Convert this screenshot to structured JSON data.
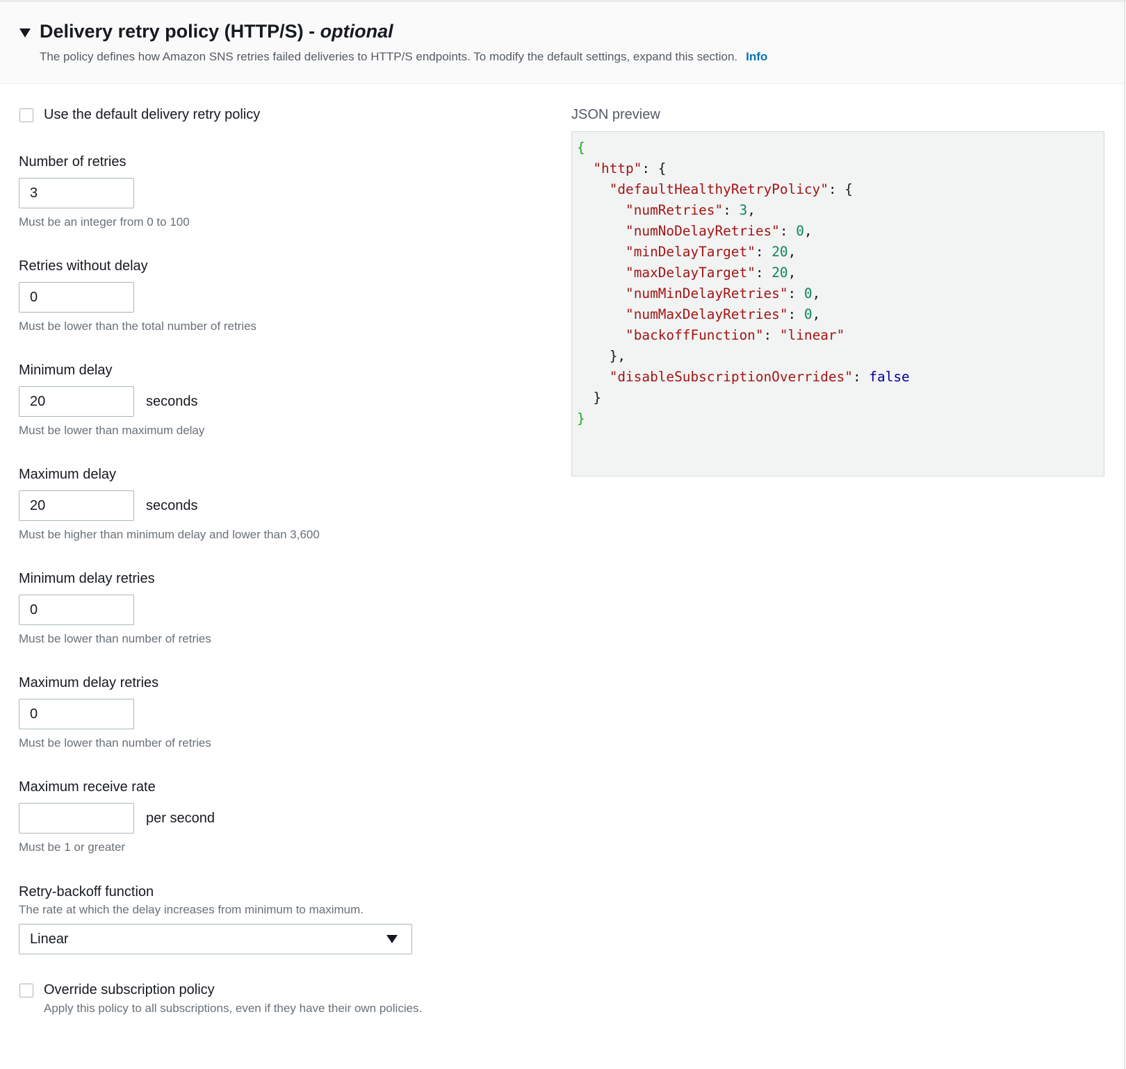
{
  "header": {
    "title": "Delivery retry policy (HTTP/S) - ",
    "title_optional": "optional",
    "description": "The policy defines how Amazon SNS retries failed deliveries to HTTP/S endpoints. To modify the default settings, expand this section.",
    "info_link": "Info"
  },
  "use_default": {
    "label": "Use the default delivery retry policy",
    "checked": false
  },
  "fields": [
    {
      "label": "Number of retries",
      "value": "3",
      "unit": "",
      "hint": "Must be an integer from 0 to 100"
    },
    {
      "label": "Retries without delay",
      "value": "0",
      "unit": "",
      "hint": "Must be lower than the total number of retries"
    },
    {
      "label": "Minimum delay",
      "value": "20",
      "unit": "seconds",
      "hint": "Must be lower than maximum delay"
    },
    {
      "label": "Maximum delay",
      "value": "20",
      "unit": "seconds",
      "hint": "Must be higher than minimum delay and lower than 3,600"
    },
    {
      "label": "Minimum delay retries",
      "value": "0",
      "unit": "",
      "hint": "Must be lower than number of retries"
    },
    {
      "label": "Maximum delay retries",
      "value": "0",
      "unit": "",
      "hint": "Must be lower than number of retries"
    },
    {
      "label": "Maximum receive rate",
      "value": "",
      "unit": "per second",
      "hint": "Must be 1 or greater"
    }
  ],
  "backoff": {
    "label": "Retry-backoff function",
    "description": "The rate at which the delay increases from minimum to maximum.",
    "selected": "Linear"
  },
  "override": {
    "label": "Override subscription policy",
    "description": "Apply this policy to all subscriptions, even if they have their own policies.",
    "checked": false
  },
  "json_preview": {
    "label": "JSON preview",
    "lines": [
      {
        "indent": 0,
        "parts": [
          [
            "g",
            "{"
          ]
        ]
      },
      {
        "indent": 1,
        "parts": [
          [
            "k",
            "\"http\""
          ],
          [
            "p",
            ": {"
          ]
        ]
      },
      {
        "indent": 2,
        "parts": [
          [
            "k",
            "\"defaultHealthyRetryPolicy\""
          ],
          [
            "p",
            ": {"
          ]
        ]
      },
      {
        "indent": 3,
        "parts": [
          [
            "k",
            "\"numRetries\""
          ],
          [
            "p",
            ": "
          ],
          [
            "n",
            "3"
          ],
          [
            "p",
            ","
          ]
        ]
      },
      {
        "indent": 3,
        "parts": [
          [
            "k",
            "\"numNoDelayRetries\""
          ],
          [
            "p",
            ": "
          ],
          [
            "n",
            "0"
          ],
          [
            "p",
            ","
          ]
        ]
      },
      {
        "indent": 3,
        "parts": [
          [
            "k",
            "\"minDelayTarget\""
          ],
          [
            "p",
            ": "
          ],
          [
            "n",
            "20"
          ],
          [
            "p",
            ","
          ]
        ]
      },
      {
        "indent": 3,
        "parts": [
          [
            "k",
            "\"maxDelayTarget\""
          ],
          [
            "p",
            ": "
          ],
          [
            "n",
            "20"
          ],
          [
            "p",
            ","
          ]
        ]
      },
      {
        "indent": 3,
        "parts": [
          [
            "k",
            "\"numMinDelayRetries\""
          ],
          [
            "p",
            ": "
          ],
          [
            "n",
            "0"
          ],
          [
            "p",
            ","
          ]
        ]
      },
      {
        "indent": 3,
        "parts": [
          [
            "k",
            "\"numMaxDelayRetries\""
          ],
          [
            "p",
            ": "
          ],
          [
            "n",
            "0"
          ],
          [
            "p",
            ","
          ]
        ]
      },
      {
        "indent": 3,
        "parts": [
          [
            "k",
            "\"backoffFunction\""
          ],
          [
            "p",
            ": "
          ],
          [
            "k",
            "\"linear\""
          ]
        ]
      },
      {
        "indent": 2,
        "parts": [
          [
            "p",
            "},"
          ]
        ]
      },
      {
        "indent": 2,
        "parts": [
          [
            "k",
            "\"disableSubscriptionOverrides\""
          ],
          [
            "p",
            ": "
          ],
          [
            "b",
            "false"
          ]
        ]
      },
      {
        "indent": 1,
        "parts": [
          [
            "p",
            "}"
          ]
        ]
      },
      {
        "indent": 0,
        "parts": [
          [
            "g",
            "}"
          ]
        ]
      }
    ]
  },
  "colors": {
    "link": "#0073bb",
    "json_key": "#a31515",
    "json_number": "#098658",
    "json_boolean": "#0000a0",
    "json_root_brace": "#22a722"
  }
}
